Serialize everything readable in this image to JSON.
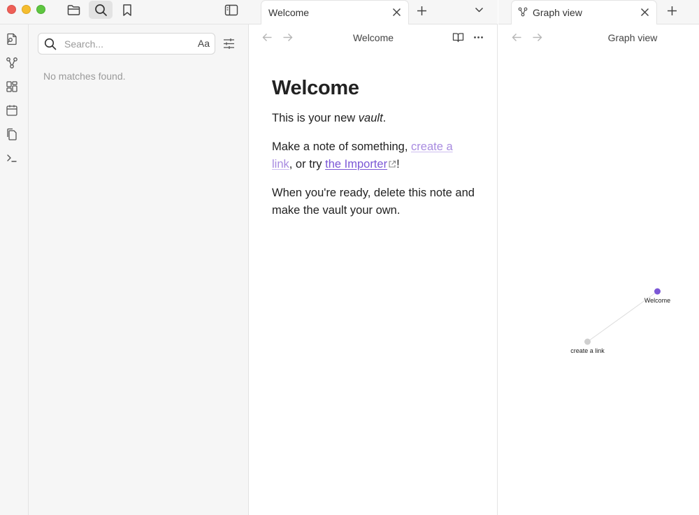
{
  "left_sidebar": {
    "search": {
      "placeholder": "Search...",
      "match_case_label": "Aa",
      "empty_message": "No matches found."
    }
  },
  "middle_pane": {
    "tab_title": "Welcome",
    "view_title": "Welcome",
    "note": {
      "heading": "Welcome",
      "p1_prefix": "This is your new ",
      "p1_em": "vault",
      "p1_suffix": ".",
      "p2_prefix": "Make a note of something, ",
      "p2_link1": "create a link",
      "p2_mid": ", or try ",
      "p2_link2": "the Importer",
      "p2_suffix": "!",
      "p3": "When you're ready, delete this note and make the vault your own."
    }
  },
  "right_pane": {
    "tab_title": "Graph view",
    "view_title": "Graph view",
    "graph": {
      "nodes": [
        {
          "label": "Welcome",
          "state": "active"
        },
        {
          "label": "create a link",
          "state": "unresolved"
        }
      ]
    }
  },
  "colors": {
    "accent": "#7b57d6",
    "unresolved_node": "#cfcfcf",
    "close_red": "#ee5f57",
    "minimize_yellow": "#f5bd2f",
    "maximize_green": "#5ec640"
  }
}
